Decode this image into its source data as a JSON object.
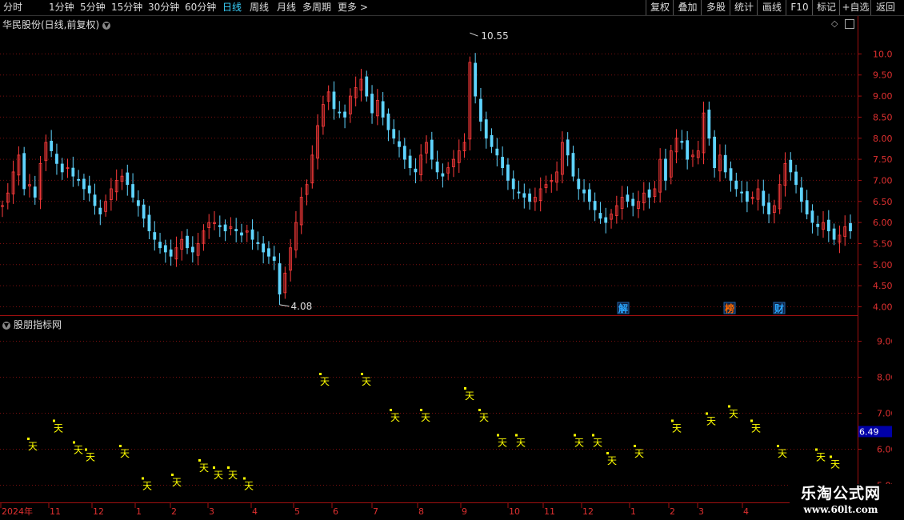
{
  "toolbar": {
    "timeframes": [
      {
        "label": "分时",
        "active": false
      },
      {
        "label": "1分钟",
        "active": false
      },
      {
        "label": "5分钟",
        "active": false
      },
      {
        "label": "15分钟",
        "active": false
      },
      {
        "label": "30分钟",
        "active": false
      },
      {
        "label": "60分钟",
        "active": false
      },
      {
        "label": "日线",
        "active": true
      },
      {
        "label": "周线",
        "active": false
      },
      {
        "label": "月线",
        "active": false
      },
      {
        "label": "多周期",
        "active": false
      },
      {
        "label": "更多 >",
        "active": false
      }
    ],
    "buttons": [
      "复权",
      "叠加",
      "多股",
      "统计",
      "画线",
      "F10",
      "标记",
      "+自选",
      "返回"
    ]
  },
  "main_chart": {
    "title": "华民股份(日线,前复权)",
    "price_axis": [
      "10.00",
      "9.50",
      "9.00",
      "8.50",
      "8.00",
      "7.50",
      "7.00",
      "6.50",
      "6.00",
      "5.50",
      "5.00",
      "4.50",
      "4.00"
    ],
    "high_marker": "10.55",
    "low_marker": "4.08",
    "event_badges": [
      "解",
      "榜",
      "财"
    ]
  },
  "indicator": {
    "title": "股朋指标网",
    "axis": [
      "9.00",
      "8.00",
      "7.00",
      "6.00",
      "5.00"
    ],
    "current_value": "6.49",
    "glyph": "天"
  },
  "date_axis": [
    "2024年",
    "11",
    "12",
    "1",
    "2",
    "3",
    "4",
    "5",
    "6",
    "7",
    "8",
    "9",
    "10",
    "11",
    "12",
    "1",
    "2",
    "3",
    "4"
  ],
  "watermark": {
    "line1": "乐淘公式网",
    "line2": "www.60lt.com"
  },
  "colors": {
    "up": "#ff3b3b",
    "down": "#5fd4ff",
    "grid": "#a01010",
    "signal": "#ffff00",
    "active_tab": "#3ad3ff"
  },
  "chart_data": {
    "type": "candlestick",
    "price_range": [
      3.8,
      10.9
    ],
    "indicator_range": [
      4.5,
      9.7
    ],
    "closes": [
      6.4,
      6.7,
      7.2,
      7.6,
      6.8,
      6.9,
      6.6,
      7.4,
      7.9,
      7.7,
      7.4,
      7.2,
      7.3,
      7.1,
      7.0,
      6.8,
      6.7,
      6.4,
      6.2,
      6.5,
      6.8,
      7.0,
      7.1,
      6.9,
      6.6,
      6.4,
      6.1,
      5.8,
      5.6,
      5.4,
      5.3,
      5.2,
      5.4,
      5.6,
      5.4,
      5.3,
      5.5,
      5.8,
      6.0,
      6.0,
      5.9,
      5.8,
      5.9,
      5.8,
      5.7,
      5.8,
      5.6,
      5.5,
      5.3,
      5.2,
      5.1,
      4.3,
      4.8,
      5.4,
      6.0,
      6.6,
      6.9,
      7.6,
      8.3,
      8.8,
      9.1,
      8.7,
      8.6,
      8.5,
      9.0,
      9.2,
      9.4,
      9.0,
      8.6,
      8.9,
      8.5,
      8.2,
      8.0,
      7.8,
      7.5,
      7.3,
      7.2,
      7.6,
      7.9,
      7.5,
      7.2,
      7.1,
      7.3,
      7.5,
      7.7,
      7.9,
      9.8,
      9.0,
      8.4,
      8.0,
      7.8,
      7.6,
      7.3,
      7.0,
      6.8,
      6.7,
      6.6,
      6.5,
      6.6,
      6.8,
      6.9,
      7.0,
      7.2,
      7.9,
      7.6,
      7.1,
      6.8,
      6.7,
      6.5,
      6.3,
      6.1,
      6.0,
      6.2,
      6.4,
      6.6,
      6.5,
      6.4,
      6.5,
      6.7,
      6.6,
      6.8,
      7.5,
      7.0,
      7.7,
      8.0,
      7.9,
      7.5,
      7.6,
      7.7,
      8.6,
      8.0,
      7.3,
      7.6,
      7.2,
      7.0,
      6.8,
      6.7,
      6.5,
      6.6,
      6.8,
      6.4,
      6.2,
      6.4,
      6.9,
      7.4,
      7.2,
      6.9,
      6.5,
      6.2,
      6.0,
      5.9,
      6.0,
      5.8,
      5.6,
      5.7,
      5.9,
      5.8
    ],
    "indicator_values": [
      6.1,
      6.6,
      6.0,
      5.8,
      5.9,
      5.0,
      5.1,
      5.5,
      5.3,
      5.3,
      5.0,
      4.2,
      7.9,
      7.9,
      6.9,
      6.9,
      7.5,
      6.9,
      6.2,
      6.2,
      6.2,
      6.2,
      5.7,
      5.9,
      6.6,
      6.8,
      7.0,
      6.6,
      5.9,
      5.8,
      5.6
    ]
  }
}
